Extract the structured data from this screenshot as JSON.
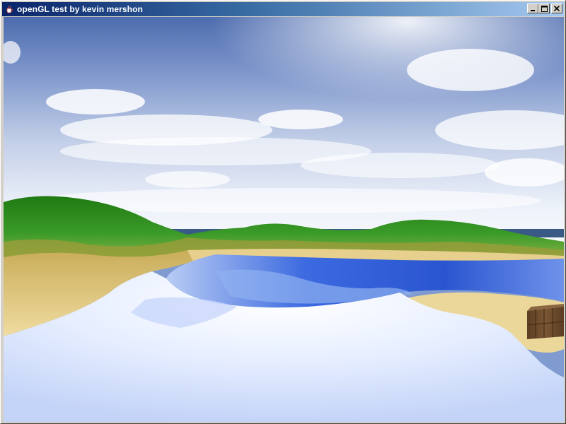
{
  "window": {
    "title": "openGL test by kevin mershon",
    "icon": "java-cup-icon",
    "controls": [
      "minimize-icon",
      "maximize-icon",
      "close-icon"
    ]
  },
  "scene": {
    "elements": [
      "sky",
      "clouds",
      "green-hills",
      "sand-beach",
      "water",
      "snow-foreground",
      "wooden-crate"
    ],
    "colors": {
      "sky_top": "#5a79b8",
      "sky_horizon": "#e6ecf6",
      "grass": "#2f8a1f",
      "sand": "#dcc27a",
      "water_deep": "#2f5fd8",
      "snow": "#f4f7ff",
      "crate": "#6b4a2c"
    }
  }
}
